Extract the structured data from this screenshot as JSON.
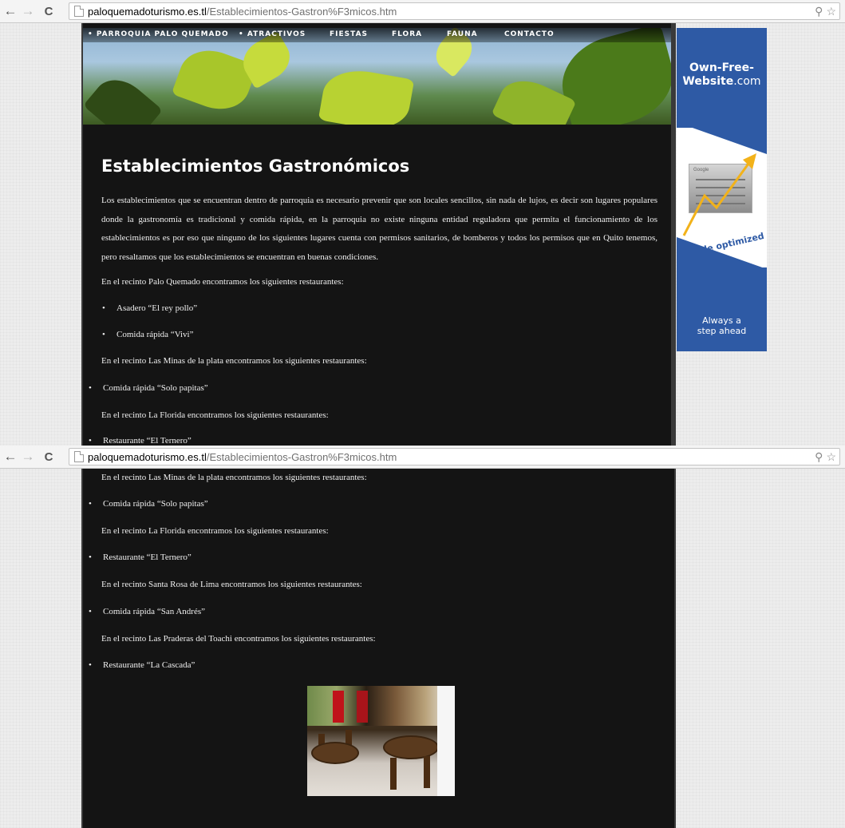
{
  "browser": {
    "url_host": "paloquemadoturismo.es.tl",
    "url_path": "/Establecimientos-Gastron%F3micos.htm",
    "back_glyph": "←",
    "forward_glyph": "→",
    "reload_glyph": "C",
    "zoom_glyph": "⚲",
    "star_glyph": "☆"
  },
  "nav": {
    "items": [
      "PARROQUIA PALO QUEMADO",
      "ATRACTIVOS",
      "FIESTAS",
      "FLORA",
      "FAUNA",
      "CONTACTO"
    ],
    "bullet": "•"
  },
  "ad": {
    "title_line1": "Own-Free-",
    "title_line2": "Website",
    "title_suffix": ".com",
    "chart_label": "Google",
    "google_label": "Google optimized",
    "tagline_line1": "Always a",
    "tagline_line2": "step ahead",
    "brand_color": "#2e5aa5",
    "arrow_color": "#f2b21a"
  },
  "content": {
    "title": "Establecimientos Gastronómicos",
    "intro": "Los establecimientos que se encuentran dentro de parroquia es necesario prevenir que son locales sencillos, sin nada de lujos, es decir son lugares populares donde la gastronomía es tradicional y comida rápida, en la parroquia no existe ninguna entidad reguladora que permita el funcionamiento de los establecimientos es por eso que ninguno de los siguientes lugares cuenta con permisos sanitarios, de bomberos y todos los permisos que en Quito tenemos, pero resaltamos que los establecimientos se encuentran en buenas condiciones.",
    "palo_quemado": "En el recinto Palo Quemado encontramos los siguientes restaurantes:",
    "asadero": "Asadero “El rey pollo”",
    "vivi": "Comida rápida “Vivi”",
    "las_minas": "En el recinto Las Minas de la plata encontramos los siguientes restaurantes:",
    "solo_papitas": "Comida rápida “Solo papitas”",
    "la_florida": "En el recinto   La Florida encontramos los siguientes restaurantes:",
    "el_ternero": "Restaurante “El Ternero”",
    "santa_rosa": "En el recinto  Santa Rosa de Lima encontramos los siguientes restaurantes:",
    "san_andres": "Comida rápida “San Andrés”",
    "praderas": "En el recinto Las Praderas del Toachi  encontramos los siguientes restaurantes:",
    "la_cascada": "Restaurante “La Cascada”"
  }
}
